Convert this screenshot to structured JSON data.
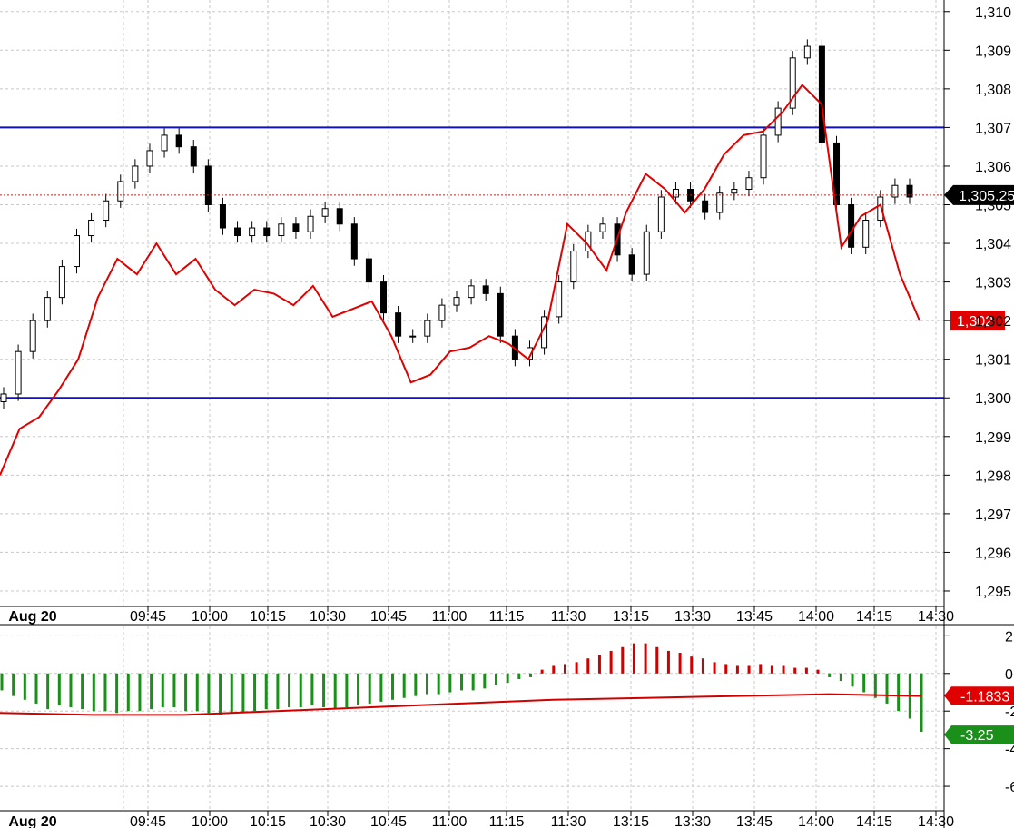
{
  "chart_data": [
    {
      "type": "candlestick",
      "date_label": "Aug 20",
      "x_ticks": [
        "09:45",
        "10:00",
        "10:15",
        "10:30",
        "10:45",
        "11:00",
        "11:15",
        "11:30",
        "13:15",
        "13:30",
        "13:45",
        "14:00",
        "14:15",
        "14:30"
      ],
      "y_ticks": [
        "1,310",
        "1,309",
        "1,308",
        "1,307",
        "1,306",
        "1,305",
        "1,304",
        "1,303",
        "1,302",
        "1,301",
        "1,300",
        "1,299",
        "1,298",
        "1,297",
        "1,296",
        "1,295"
      ],
      "ylim": [
        1294.6,
        1310.3
      ],
      "grid": true,
      "horizontal_lines": [
        1307,
        1300
      ],
      "price_series_close": [
        1300.1,
        1301.2,
        1302.0,
        1302.6,
        1303.4,
        1304.2,
        1304.6,
        1305.1,
        1305.6,
        1306.0,
        1306.4,
        1306.8,
        1306.5,
        1306.0,
        1305.0,
        1304.4,
        1304.2,
        1304.4,
        1304.2,
        1304.5,
        1304.3,
        1304.7,
        1304.9,
        1304.5,
        1303.6,
        1303.0,
        1302.2,
        1301.6,
        1301.6,
        1302.0,
        1302.4,
        1302.6,
        1302.9,
        1302.7,
        1301.6,
        1301.0,
        1301.3,
        1302.1,
        1303.0,
        1303.8,
        1304.3,
        1304.5,
        1303.7,
        1303.2,
        1304.3,
        1305.2,
        1305.4,
        1305.1,
        1304.8,
        1305.3,
        1305.4,
        1305.7,
        1306.8,
        1307.5,
        1308.8,
        1309.1,
        1306.6,
        1305.0,
        1303.9,
        1304.6,
        1305.2,
        1305.5,
        1305.2
      ],
      "series": [
        {
          "name": "",
          "color": "#e00000",
          "values": [
            1298.0,
            1299.2,
            1299.5,
            1300.2,
            1301.0,
            1302.6,
            1303.6,
            1303.2,
            1304.0,
            1303.2,
            1303.6,
            1302.8,
            1302.4,
            1302.8,
            1302.7,
            1302.4,
            1302.9,
            1302.1,
            1302.3,
            1302.5,
            1301.6,
            1300.4,
            1300.6,
            1301.2,
            1301.3,
            1301.6,
            1301.4,
            1301.0,
            1302.0,
            1304.5,
            1304.0,
            1303.3,
            1304.8,
            1305.8,
            1305.4,
            1304.8,
            1305.4,
            1306.3,
            1306.8,
            1306.9,
            1307.4,
            1308.1,
            1307.6,
            1303.9,
            1304.7,
            1305.0,
            1303.2,
            1302.0
          ],
          "last_value_label": "1,302"
        }
      ],
      "last_price_label": "1,305.25",
      "last_price": 1305.25
    },
    {
      "type": "bar",
      "y_ticks": [
        "2",
        "0",
        "-2",
        "-4",
        "-6"
      ],
      "ylim": [
        -7.3,
        2.5
      ],
      "histogram": [
        -0.9,
        -1.2,
        -1.4,
        -1.6,
        -1.9,
        -1.7,
        -1.8,
        -1.9,
        -2.0,
        -2.0,
        -2.1,
        -2.0,
        -2.0,
        -1.9,
        -1.8,
        -1.8,
        -2.0,
        -2.0,
        -2.1,
        -2.2,
        -2.1,
        -2.1,
        -2.0,
        -1.9,
        -1.9,
        -1.8,
        -1.8,
        -1.7,
        -1.8,
        -1.9,
        -1.8,
        -1.7,
        -1.6,
        -1.5,
        -1.4,
        -1.3,
        -1.2,
        -1.1,
        -1.1,
        -1.0,
        -0.9,
        -0.9,
        -0.8,
        -0.6,
        -0.5,
        -0.3,
        -0.2,
        0.2,
        0.4,
        0.5,
        0.6,
        0.8,
        1.0,
        1.2,
        1.4,
        1.6,
        1.6,
        1.4,
        1.2,
        1.1,
        0.9,
        0.8,
        0.6,
        0.5,
        0.4,
        0.4,
        0.5,
        0.4,
        0.4,
        0.3,
        0.3,
        0.2,
        -0.2,
        -0.4,
        -0.7,
        -1.0,
        -1.3,
        -1.6,
        -2.0,
        -2.4,
        -3.1
      ],
      "series": [
        {
          "name": "",
          "color": "#d00000",
          "values": [
            -2.1,
            -2.2,
            -2.2,
            -2.0,
            -1.8,
            -1.6,
            -1.4,
            -1.3,
            -1.2,
            -1.1,
            -1.2
          ]
        }
      ],
      "tags": [
        {
          "label": "-1.1833",
          "value": -1.1833,
          "color": "#e00000"
        },
        {
          "label": "-3.25",
          "value": -3.25,
          "color": "#1a8f1a"
        }
      ],
      "colors": {
        "positive": "#d00000",
        "negative": "#1a8f1a"
      }
    }
  ]
}
